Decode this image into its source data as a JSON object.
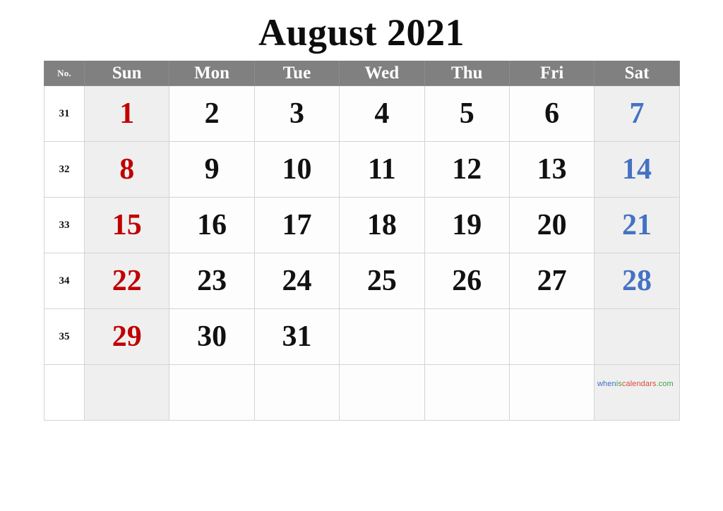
{
  "title": "August 2021",
  "header": {
    "week_no_label": "No.",
    "days": [
      "Sun",
      "Mon",
      "Tue",
      "Wed",
      "Thu",
      "Fri",
      "Sat"
    ]
  },
  "colors": {
    "header_bg": "#808080",
    "header_text": "#ffffff",
    "sunday_text": "#c00000",
    "saturday_text": "#4472c4",
    "weekday_text": "#111111",
    "weekend_cell_bg": "#efefef",
    "weekday_cell_bg": "#fdfdfd",
    "grid_line": "#d4d4d4"
  },
  "weeks": [
    {
      "no": "31",
      "days": [
        "1",
        "2",
        "3",
        "4",
        "5",
        "6",
        "7"
      ]
    },
    {
      "no": "32",
      "days": [
        "8",
        "9",
        "10",
        "11",
        "12",
        "13",
        "14"
      ]
    },
    {
      "no": "33",
      "days": [
        "15",
        "16",
        "17",
        "18",
        "19",
        "20",
        "21"
      ]
    },
    {
      "no": "34",
      "days": [
        "22",
        "23",
        "24",
        "25",
        "26",
        "27",
        "28"
      ]
    },
    {
      "no": "35",
      "days": [
        "29",
        "30",
        "31",
        "",
        "",
        "",
        ""
      ]
    },
    {
      "no": "",
      "days": [
        "",
        "",
        "",
        "",
        "",
        "",
        ""
      ]
    }
  ],
  "watermark": {
    "part1": "when",
    "part2": "is",
    "part3": "calendars",
    "part4": ".com"
  }
}
